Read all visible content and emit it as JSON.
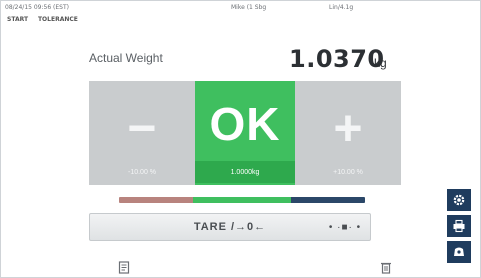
{
  "status": {
    "datetime": "08/24/15 09:56 (EST)",
    "user": "Mike (1 Sbg",
    "balance": "Lin/4.1g"
  },
  "breadcrumb": {
    "start": "START",
    "mode": "TOLERANCE"
  },
  "weight": {
    "label": "Actual Weight",
    "value": "1.0370",
    "unit": "kg"
  },
  "panels": {
    "minus": {
      "sign": "−",
      "limit": "-10.00 %"
    },
    "ok": {
      "sign": "OK",
      "target": "1.0000kg"
    },
    "plus": {
      "sign": "+",
      "limit": "+10.00 %"
    }
  },
  "tolerance_bar": {
    "colors": [
      "#b8837e",
      "#3fbf5f",
      "#2b4768"
    ]
  },
  "tare": {
    "label": "TARE /→0←"
  },
  "level_indicator": {
    "label": "• ·■· •"
  },
  "colors": {
    "ok_green": "#3fbf5f",
    "neutral_gray": "#c9ccce",
    "sidebar_blue": "#1f3c5e"
  },
  "icons": {
    "bottom_left": "document-icon",
    "bottom_right": "delete-icon",
    "side": [
      "settings-icon",
      "printer-icon",
      "scale-icon"
    ]
  }
}
